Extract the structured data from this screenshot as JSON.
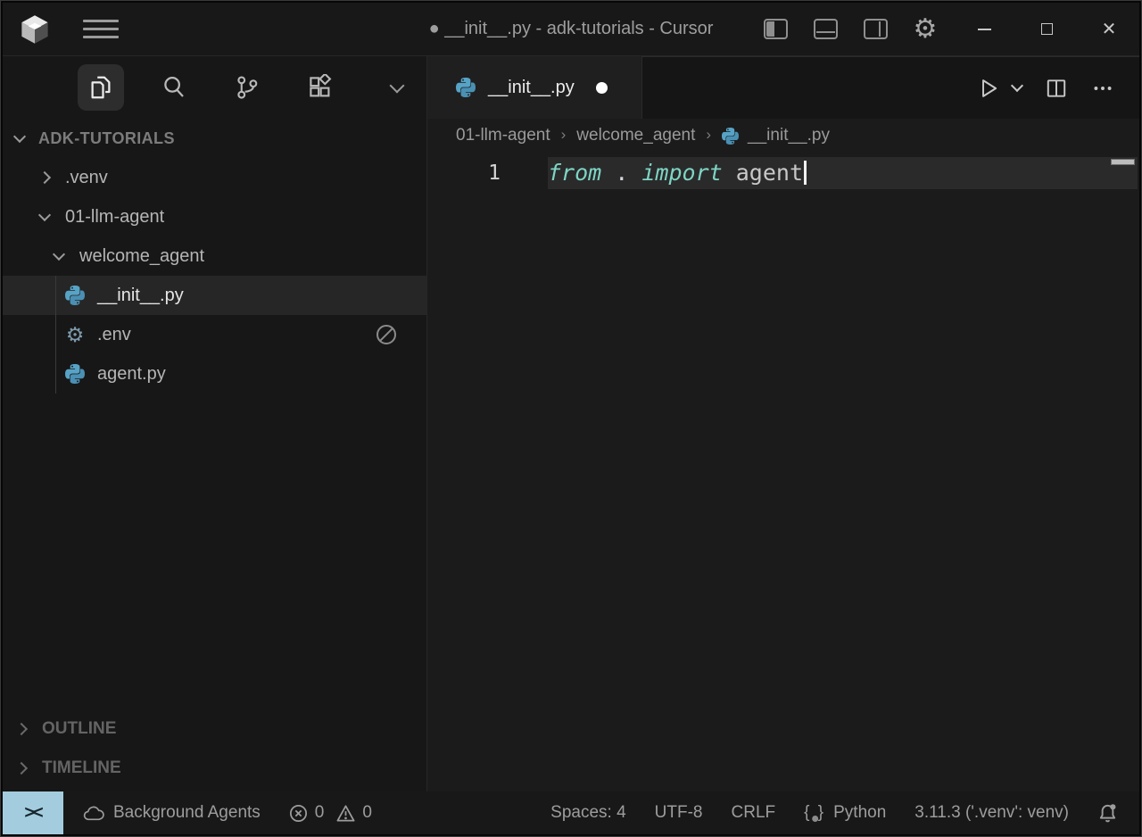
{
  "window": {
    "title": "● __init__.py - adk-tutorials - Cursor",
    "close_glyph": "✕"
  },
  "activity_bar": {
    "icons": [
      "explorer-files-icon",
      "search-icon",
      "source-control-icon",
      "extensions-icon",
      "more-views-chevron-icon"
    ]
  },
  "explorer": {
    "root_label": "ADK-TUTORIALS",
    "items": [
      {
        "label": ".venv"
      },
      {
        "label": "01-llm-agent"
      },
      {
        "label": "welcome_agent"
      },
      {
        "label": "__init__.py"
      },
      {
        "label": ".env"
      },
      {
        "label": "agent.py"
      }
    ],
    "outline_label": "OUTLINE",
    "timeline_label": "TIMELINE"
  },
  "editor": {
    "tab_label": "__init__.py",
    "breadcrumb": {
      "p1": "01-llm-agent",
      "p2": "welcome_agent",
      "p3": "__init__.py",
      "sep": "›"
    },
    "line_number": "1",
    "code": {
      "kw1": "from",
      "dot": " . ",
      "kw2": "import",
      "name": " agent"
    }
  },
  "status_bar": {
    "remote_glyph": "><",
    "background_agents": "Background Agents",
    "errors": "0",
    "warnings": "0",
    "spaces": "Spaces: 4",
    "encoding": "UTF-8",
    "eol": "CRLF",
    "language": "Python",
    "lang_icon_braces_open": "{",
    "lang_icon_braces_close": "}",
    "interpreter": "3.11.3 ('.venv': venv)"
  },
  "colors": {
    "remote_bg": "#a3cdde",
    "keyword": "#7ed5c5",
    "python_icon_top": "#57a3c6",
    "python_icon_bottom": "#4a90b4",
    "editor_bg": "#1b1b1b",
    "current_line": "#2a2a2a"
  }
}
